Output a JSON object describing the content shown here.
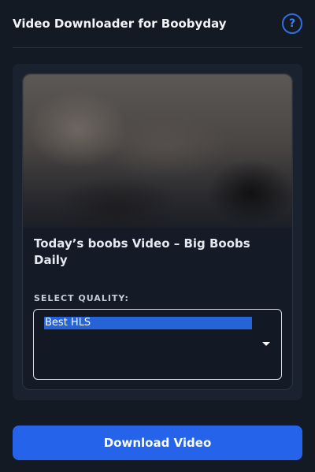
{
  "header": {
    "title": "Video Downloader for Boobyday",
    "help_label": "?"
  },
  "video": {
    "title": "Today’s boobs Video – Big Boobs Daily"
  },
  "quality": {
    "label": "SELECT QUALITY:",
    "selected": "Best HLS"
  },
  "actions": {
    "download_label": "Download Video"
  },
  "colors": {
    "accent": "#2563eb",
    "background": "#141a24",
    "panel": "#1a2230"
  }
}
